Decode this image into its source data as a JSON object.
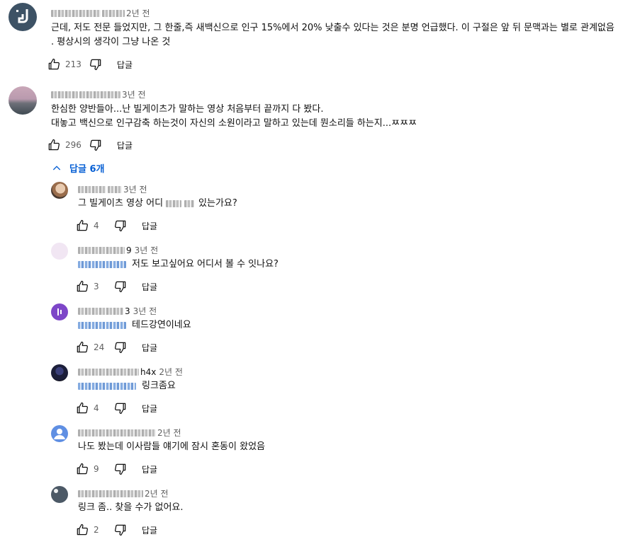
{
  "comments": [
    {
      "time": "2년 전",
      "lines": [
        "근데, 저도 전문 들었지만, 그 한줄,즉 새백신으로 인구 15%에서 20% 낮출수 있다는 것은 분명 언급했다. 이 구절은 앞 뒤 문맥과는 별로 관계없음",
        ". 평상시의 생각이 그냥 나온 것"
      ],
      "likes": "213",
      "reply_label": "답글"
    },
    {
      "time": "3년 전",
      "lines": [
        "한심한 양반들아...난 빌게이츠가 말하는 영상  처음부터 끝까지 다 봤다.",
        "대놓고 백신으로 인구감축 하는것이 자신의  소원이라고 말하고 있는데 뭔소리들 하는지...ㅉㅉㅉ"
      ],
      "likes": "296",
      "reply_label": "답글"
    }
  ],
  "replies_toggle": "답글 6개",
  "replies": [
    {
      "time": "3년 전",
      "lines": [
        "그 빌게이츠 영상 어디",
        "있는가요?"
      ],
      "likes": "4",
      "reply_label": "답글"
    },
    {
      "name_suffix": "9",
      "time": "3년 전",
      "text": "저도 보고싶어요 어디서 볼 수 잇나요?",
      "likes": "3",
      "reply_label": "답글"
    },
    {
      "name_suffix": "3",
      "time": "3년 전",
      "text": "테드강연이네요",
      "likes": "24",
      "reply_label": "답글"
    },
    {
      "name_suffix": "h4x",
      "time": "2년 전",
      "text": "링크좀요",
      "likes": "4",
      "reply_label": "답글"
    },
    {
      "time": "2년 전",
      "text": "나도 봤는데 이사람들 얘기에 잠시 혼동이 왔었음",
      "likes": "9",
      "reply_label": "답글"
    },
    {
      "time": "2년 전",
      "text": "링크 좀.. 찾을 수가 없어요.",
      "likes": "2",
      "reply_label": "답글"
    }
  ],
  "colors": {
    "link_blue": "#065fd4",
    "meta_gray": "#606060",
    "text": "#0f0f0f"
  },
  "icons": [
    "thumb-up-icon",
    "thumb-down-icon",
    "chevron-up-icon"
  ]
}
